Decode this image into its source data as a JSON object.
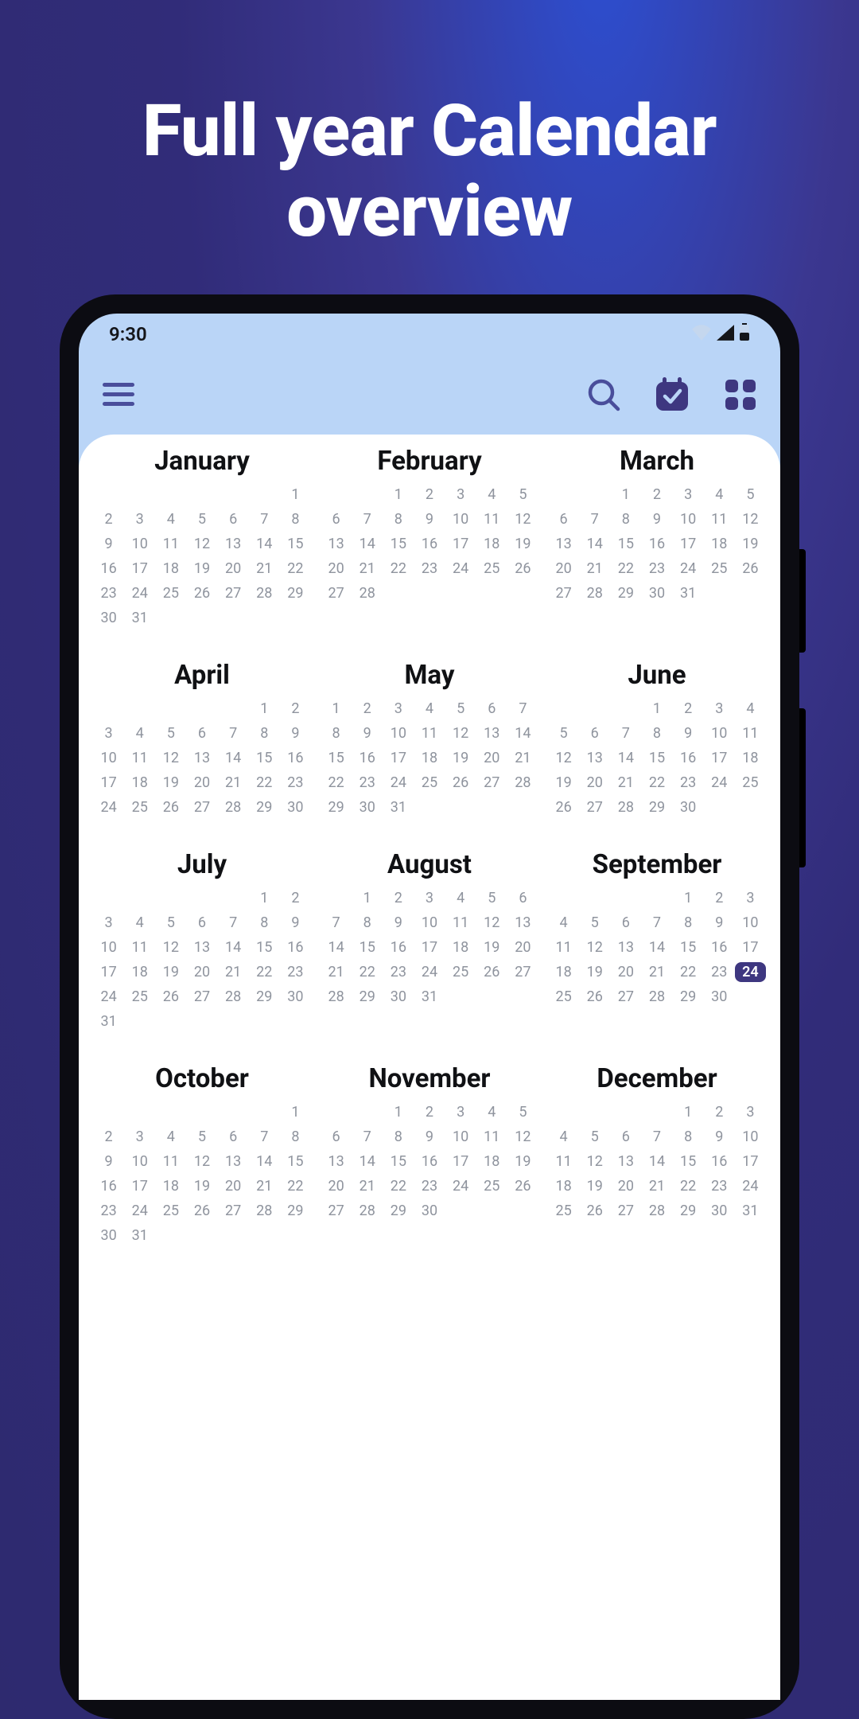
{
  "headline_line1": "Full year Calendar",
  "headline_line2": "overview",
  "status": {
    "time": "9:30"
  },
  "icons": {
    "menu": "menu-icon",
    "search": "search-icon",
    "calendar_check": "calendar-check-icon",
    "grid": "grid-icon",
    "wifi": "wifi-icon",
    "signal": "signal-icon",
    "battery": "battery-icon"
  },
  "colors": {
    "accent": "#3e3780",
    "app_header": "#bad5f7"
  },
  "today": {
    "month_index": 8,
    "day": 24
  },
  "months": [
    {
      "name": "January",
      "lead": 6,
      "days": 31
    },
    {
      "name": "February",
      "lead": 2,
      "days": 28
    },
    {
      "name": "March",
      "lead": 2,
      "days": 31
    },
    {
      "name": "April",
      "lead": 5,
      "days": 30
    },
    {
      "name": "May",
      "lead": 0,
      "days": 31
    },
    {
      "name": "June",
      "lead": 3,
      "days": 30
    },
    {
      "name": "July",
      "lead": 5,
      "days": 31
    },
    {
      "name": "August",
      "lead": 1,
      "days": 31
    },
    {
      "name": "September",
      "lead": 4,
      "days": 30
    },
    {
      "name": "October",
      "lead": 6,
      "days": 31
    },
    {
      "name": "November",
      "lead": 2,
      "days": 30
    },
    {
      "name": "December",
      "lead": 4,
      "days": 31
    }
  ]
}
